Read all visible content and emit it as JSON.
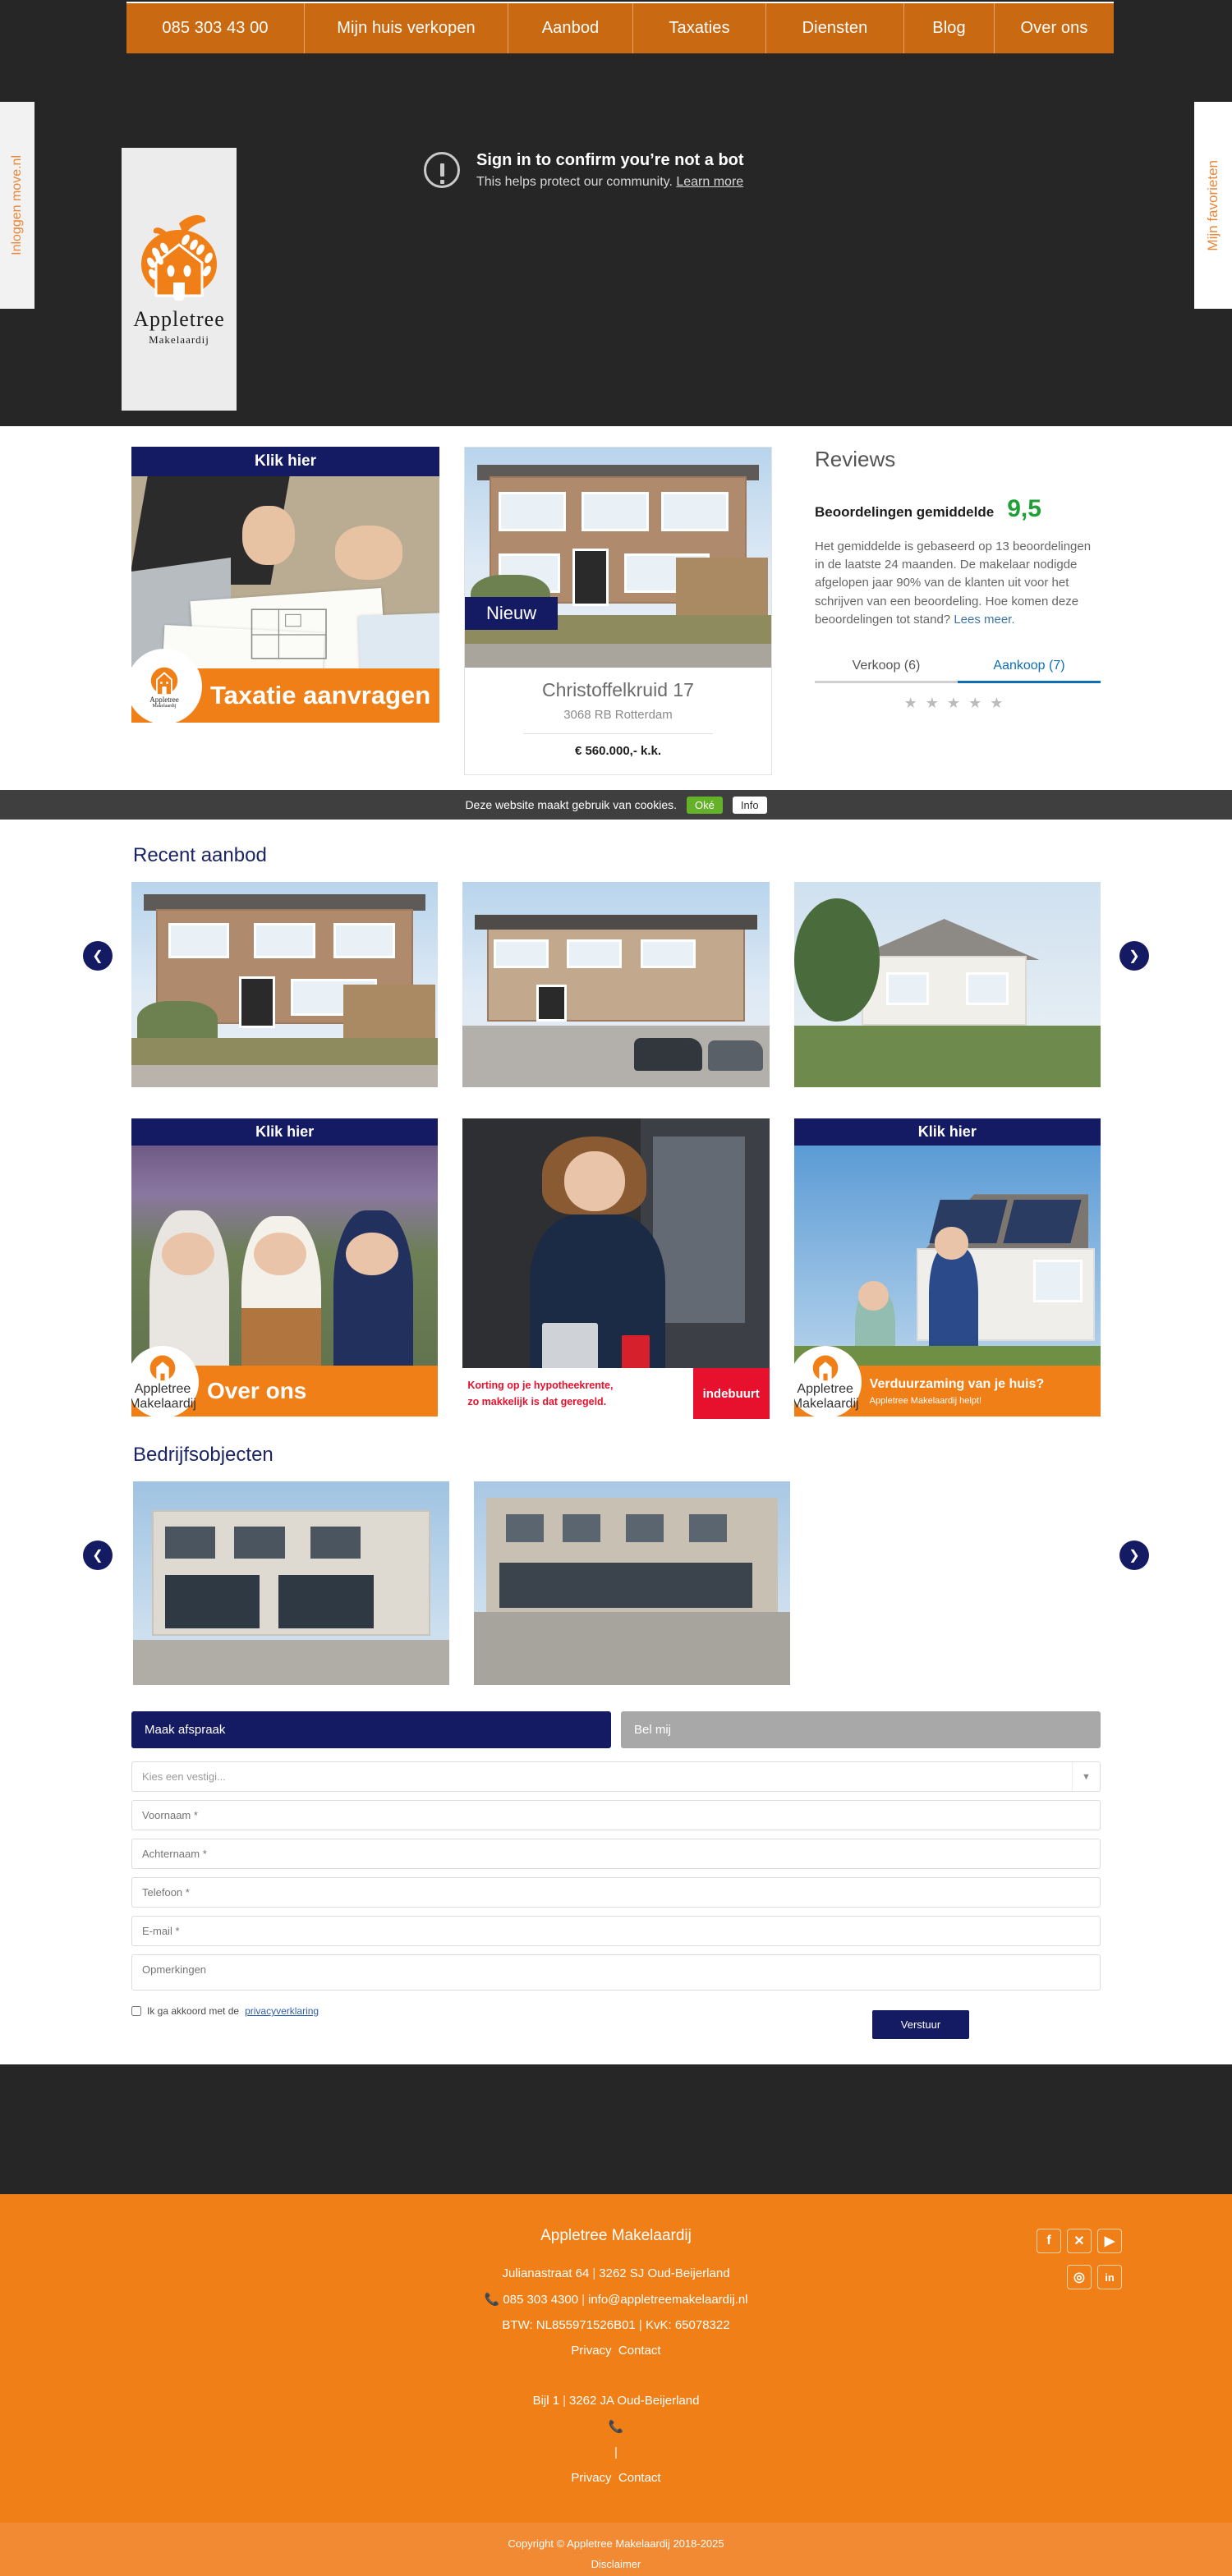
{
  "nav": {
    "items": [
      {
        "label": "085 303 43 00",
        "cls": "nav-ph"
      },
      {
        "label": "Mijn huis verkopen",
        "cls": "nav-sell"
      },
      {
        "label": "Aanbod",
        "cls": "nav-aanbod"
      },
      {
        "label": "Taxaties",
        "cls": "nav-tax"
      },
      {
        "label": "Diensten",
        "cls": "nav-dien"
      },
      {
        "label": "Blog",
        "cls": "nav-blog"
      },
      {
        "label": "Over ons",
        "cls": "nav-over"
      }
    ]
  },
  "bot_banner": {
    "title": "Sign in to confirm you’re not a bot",
    "subtitle": "This helps protect our community.",
    "link": "Learn more",
    "icon": "exclamation-circle-icon"
  },
  "logo": {
    "name": "Appletree",
    "subtitle": "Makelaardij",
    "icon": "apple-house-logo"
  },
  "side_tabs": {
    "left": "Inloggen move.nl",
    "right": "Mijn favorieten"
  },
  "promo_taxatie": {
    "head": "Klik hier",
    "cta": "Taxatie aanvragen",
    "badge_name": "Appletree",
    "badge_sub": "Makelaardij"
  },
  "listing": {
    "badge": "Nieuw",
    "title": "Christoffelkruid 17",
    "location": "3068 RB Rotterdam",
    "price": "€ 560.000,- k.k."
  },
  "reviews": {
    "heading": "Reviews",
    "avg_label": "Beoordelingen gemiddelde",
    "avg_value": "9,5",
    "body": "Het gemiddelde is gebaseerd op 13 beoordelingen in de laatste 24 maanden. De makelaar nodigde afgelopen jaar 90% van de klanten uit voor het schrijven van een beoordeling.\nHoe komen deze beoordelingen tot stand?",
    "read_more": "Lees meer.",
    "tab_sell": "Verkoop (6)",
    "tab_buy": "Aankoop (7)",
    "accent": "#0f6fb5",
    "score_color": "#21a038"
  },
  "cookiebar": {
    "text": "Deze website maakt gebruik van cookies.",
    "ok": "Oké",
    "info": "Info"
  },
  "recent": {
    "title": "Recent aanbod",
    "prev_icon": "chevron-left-icon",
    "next_icon": "chevron-right-icon",
    "items": [
      {
        "name": "listing-thumb-1"
      },
      {
        "name": "listing-thumb-2"
      },
      {
        "name": "listing-thumb-3"
      }
    ]
  },
  "banners": [
    {
      "head": "Klik hier",
      "cta": "Over ons",
      "type": "orange"
    },
    {
      "head": "",
      "line1": "Korting op je hypotheekrente,",
      "line2": "zo makkelijk is dat geregeld.",
      "brand": "indebuurt",
      "type": "white"
    },
    {
      "head": "Klik hier",
      "cta": "Verduurzaming van je huis?",
      "sub": "Appletree Makelaardij helpt!",
      "type": "orange"
    }
  ],
  "bedrijf": {
    "title": "Bedrijfsobjecten",
    "prev_icon": "chevron-left-icon",
    "next_icon": "chevron-right-icon",
    "items": [
      {
        "name": "commercial-thumb-1"
      },
      {
        "name": "commercial-thumb-2"
      }
    ]
  },
  "form": {
    "tab_appointment": "Maak afspraak",
    "tab_callme": "Bel mij",
    "select_value": "Kies een vestigi...",
    "chevron": "⌄",
    "fields": [
      {
        "placeholder": "Voornaam *",
        "name": "firstname-field"
      },
      {
        "placeholder": "Achternaam *",
        "name": "lastname-field"
      },
      {
        "placeholder": "Telefoon *",
        "name": "phone-field"
      },
      {
        "placeholder": "E-mail *",
        "name": "email-field"
      }
    ],
    "remarks_placeholder": "Opmerkingen",
    "agree_text": "Ik ga akkoord met de",
    "agree_link": "privacyverklaring",
    "submit": "Verstuur"
  },
  "footer": {
    "company": "Appletree Makelaardij",
    "address1": "Julianastraat 64",
    "postcode1": "3262 SJ Oud-Beijerland",
    "phone1": "085 303 4300",
    "email1": "info@appletreemakelaardij.nl",
    "tax": "BTW: NL855971526B01 | KvK: 65078322",
    "privacy": "Privacy",
    "contact": "Contact",
    "address2": "Bijl 1",
    "postcode2": "3262 JA Oud-Beijerland",
    "phone2": "",
    "sep": "|",
    "privacy2": "Privacy",
    "contact2": "Contact",
    "socials": [
      {
        "name": "facebook-icon",
        "glyph": "f"
      },
      {
        "name": "x-twitter-icon",
        "glyph": "✕"
      },
      {
        "name": "youtube-icon",
        "glyph": "▶"
      },
      {
        "name": "instagram-icon",
        "glyph": "◎"
      },
      {
        "name": "linkedin-icon",
        "glyph": "in"
      }
    ],
    "copyright": "Copyright © Appletree Makelaardij 2018-2025",
    "disclaimer": "Disclaimer"
  }
}
